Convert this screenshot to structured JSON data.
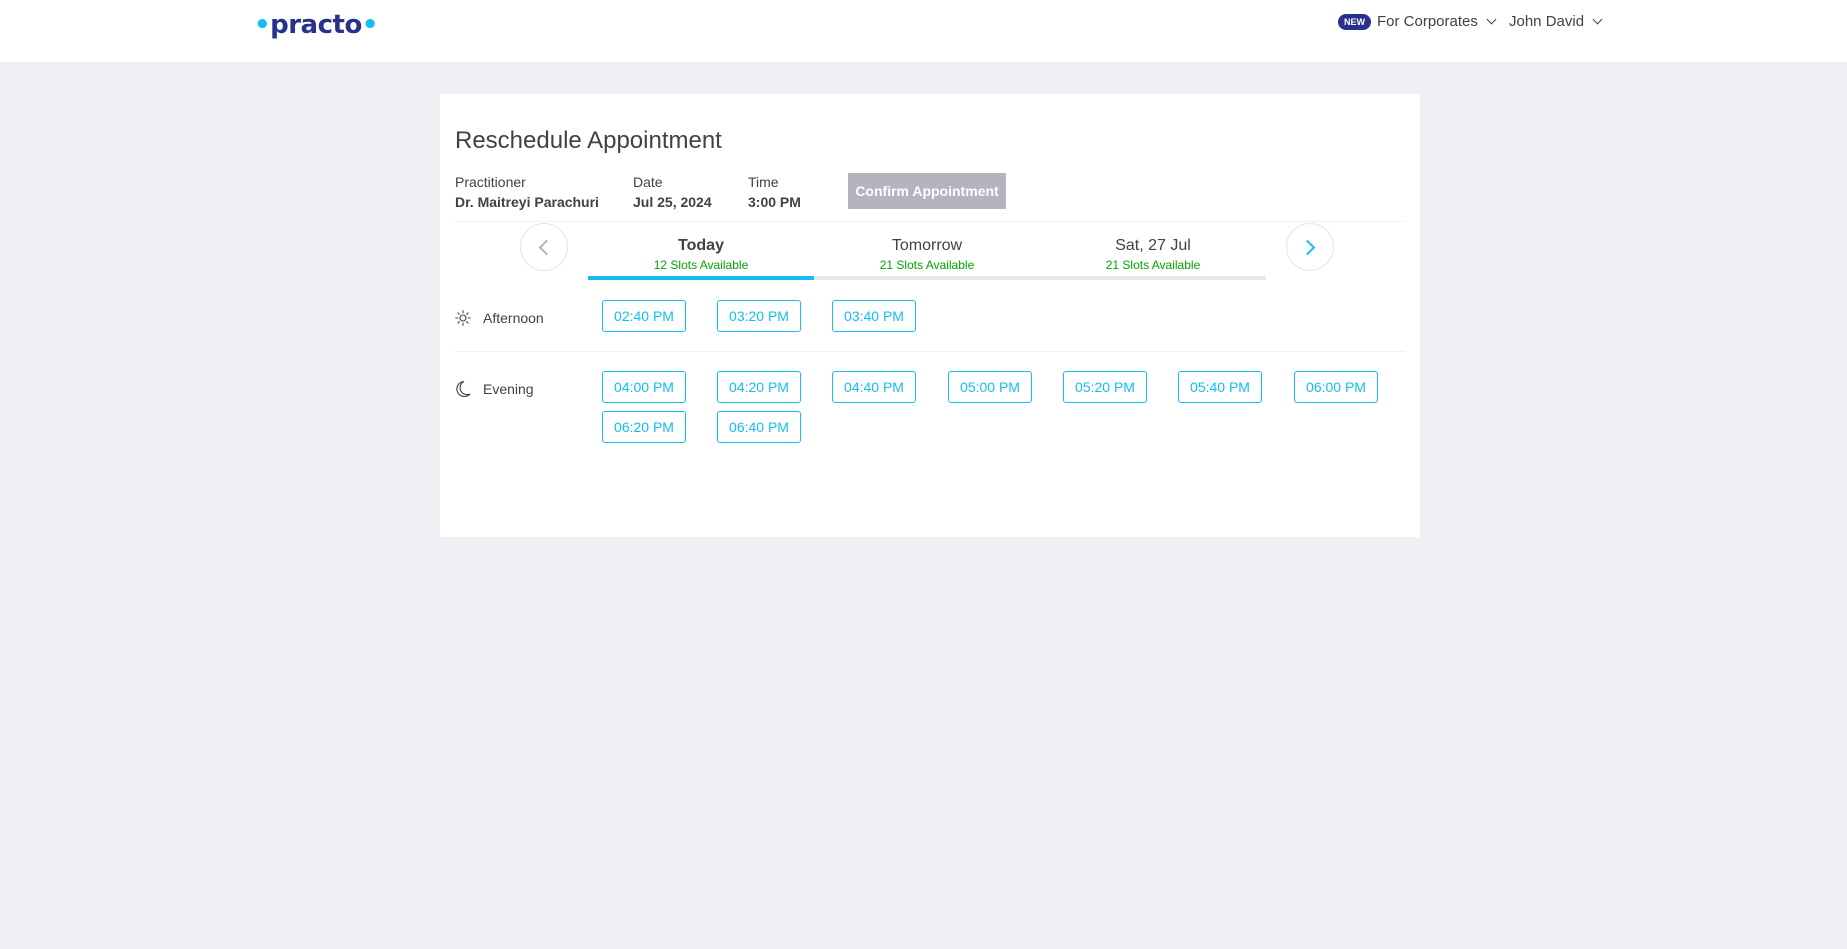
{
  "header": {
    "logo_text": "practo",
    "new_badge": "NEW",
    "corporates_label": "For Corporates",
    "user_name": "John David"
  },
  "page": {
    "title": "Reschedule Appointment",
    "practitioner_label": "Practitioner",
    "practitioner_value": "Dr. Maitreyi Parachuri",
    "date_label": "Date",
    "date_value": "Jul 25, 2024",
    "time_label": "Time",
    "time_value": "3:00 PM",
    "confirm_label": "Confirm Appointment"
  },
  "days": [
    {
      "name": "Today",
      "slots": "12 Slots Available",
      "active": true
    },
    {
      "name": "Tomorrow",
      "slots": "21 Slots Available",
      "active": false
    },
    {
      "name": "Sat, 27 Jul",
      "slots": "21 Slots Available",
      "active": false
    }
  ],
  "sessions": {
    "afternoon": {
      "label": "Afternoon",
      "icon": "sun-icon",
      "slots": [
        "02:40 PM",
        "03:20 PM",
        "03:40 PM"
      ]
    },
    "evening": {
      "label": "Evening",
      "icon": "moon-icon",
      "slots": [
        "04:00 PM",
        "04:20 PM",
        "04:40 PM",
        "05:00 PM",
        "05:20 PM",
        "05:40 PM",
        "06:00 PM",
        "06:20 PM",
        "06:40 PM"
      ]
    }
  },
  "colors": {
    "brand": "#28328c",
    "accent": "#14bef0",
    "available": "#01a400",
    "disabled_button": "#b4b4be"
  }
}
